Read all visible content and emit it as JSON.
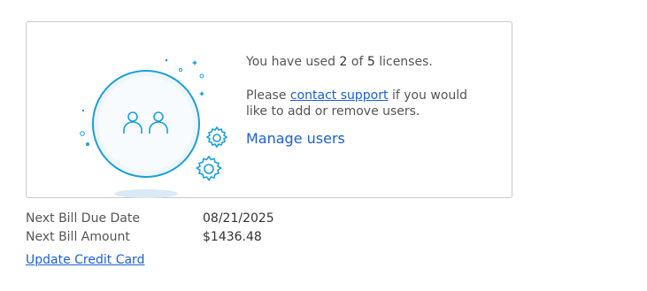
{
  "license_card": {
    "usage_prefix": "You have used",
    "used": "2",
    "of_word": "of",
    "total": "5",
    "usage_suffix": "licenses.",
    "support_prefix": "Please",
    "support_link": "contact support",
    "support_suffix": "if you would like to add or remove users.",
    "manage_label": "Manage users",
    "illustration_icon": "users-icon",
    "accent_color": "#1a9fd9",
    "link_color": "#1a5fd6"
  },
  "billing": {
    "next_due_label": "Next Bill Due Date",
    "next_due_value": "08/21/2025",
    "next_amount_label": "Next Bill Amount",
    "next_amount_value": "$1436.48"
  },
  "update_cc_label": "Update Credit Card"
}
